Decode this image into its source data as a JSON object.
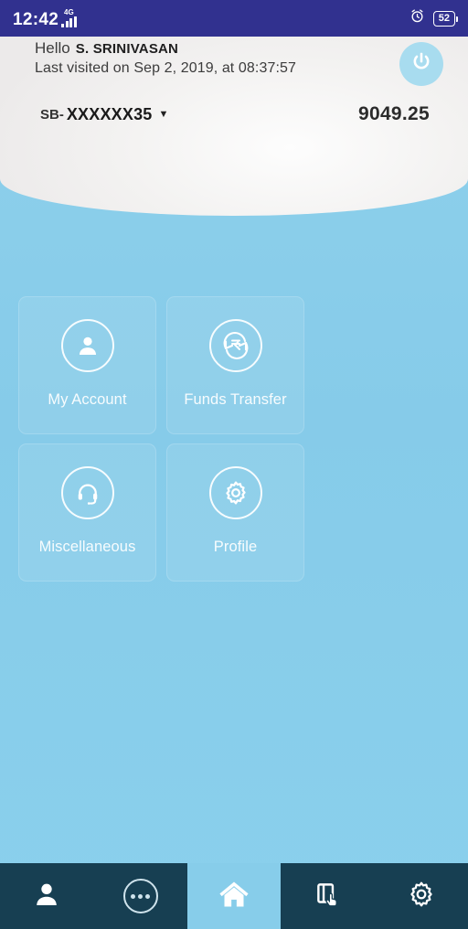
{
  "status_bar": {
    "time": "12:42",
    "network_type": "4G",
    "signal_icon": "signal-bars-icon",
    "alarm_icon": "alarm-clock-icon",
    "battery_level": "52",
    "background_color": "#31318f"
  },
  "header": {
    "greeting": "Hello",
    "user_name": "S. SRINIVASAN",
    "last_visited": "Last visited on Sep 2, 2019, at 08:37:57",
    "power_icon": "power-icon",
    "account": {
      "prefix": "SB-",
      "number": "XXXXXX35",
      "caret": "▼",
      "balance": "9049.25"
    }
  },
  "menu": {
    "tiles": [
      {
        "label": "My Account",
        "icon": "person-icon"
      },
      {
        "label": "Funds Transfer",
        "icon": "rupee-transfer-icon"
      },
      {
        "label": "Miscellaneous",
        "icon": "headset-icon"
      },
      {
        "label": "Profile",
        "icon": "gear-icon"
      }
    ]
  },
  "bottom_nav": {
    "items": [
      {
        "icon": "person-icon",
        "active": false
      },
      {
        "icon": "more-dots-icon",
        "active": false
      },
      {
        "icon": "home-icon",
        "active": true
      },
      {
        "icon": "card-tap-icon",
        "active": false
      },
      {
        "icon": "gear-icon",
        "active": false
      }
    ],
    "background_color": "#173f52",
    "active_color": "#87cdea"
  },
  "theme": {
    "page_background": "#87cdea",
    "header_background": "#f0efee",
    "accent": "#a8dcef"
  }
}
